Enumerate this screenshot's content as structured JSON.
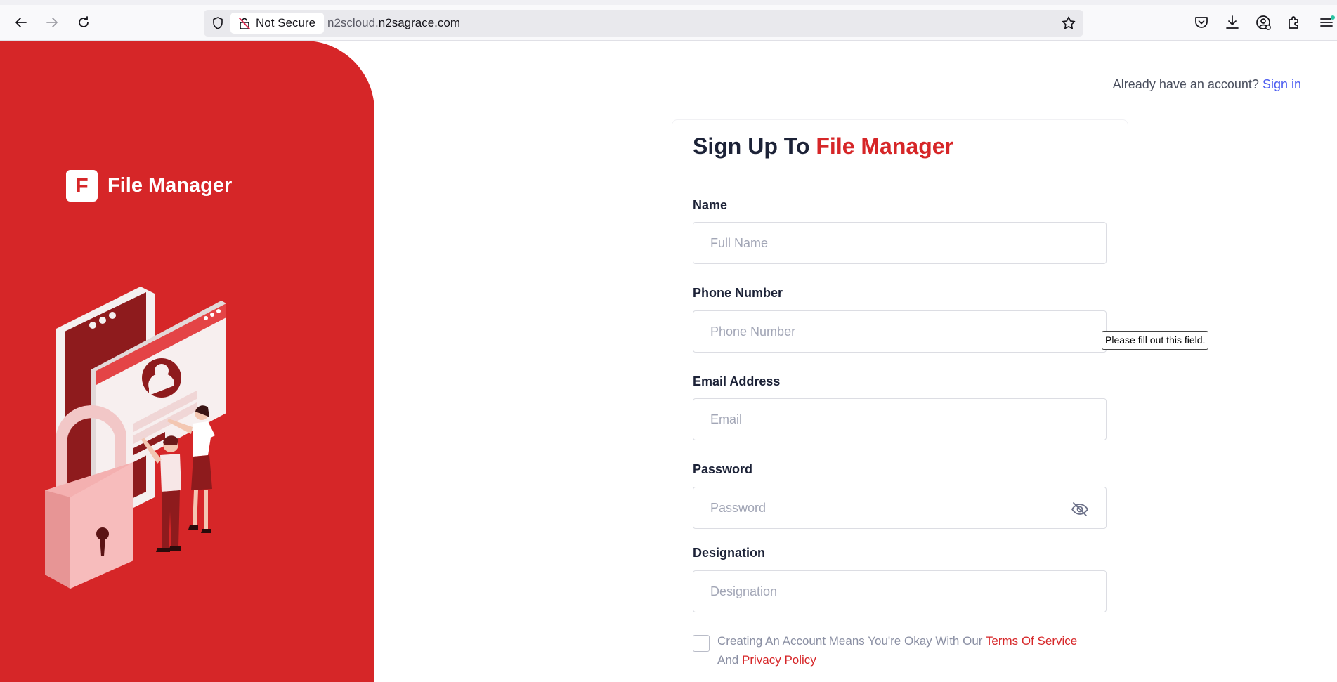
{
  "browser": {
    "security_label": "Not Secure",
    "url_prefix": "n2scloud.",
    "url_domain": "n2sagrace.com"
  },
  "brand": {
    "logo_letter": "F",
    "name": "File Manager"
  },
  "header": {
    "prompt": "Already have an account?",
    "signin_link": "Sign in"
  },
  "form": {
    "title_prefix": "Sign Up To",
    "title_accent": "File Manager",
    "fields": [
      {
        "label": "Name",
        "placeholder": "Full Name",
        "value": ""
      },
      {
        "label": "Phone Number",
        "placeholder": "Phone Number",
        "value": ""
      },
      {
        "label": "Email Address",
        "placeholder": "Email",
        "value": ""
      },
      {
        "label": "Password",
        "placeholder": "Password",
        "value": ""
      },
      {
        "label": "Designation",
        "placeholder": "Designation",
        "value": ""
      }
    ],
    "validation_tooltip": "Please fill out this field.",
    "terms": {
      "text_before": "Creating An Account Means You're Okay With Our",
      "terms_link": "Terms Of Service",
      "and": "And",
      "privacy_link": "Privacy Policy",
      "checked": false
    }
  },
  "colors": {
    "brand_red": "#d62628",
    "link_blue": "#4b5cf0",
    "heading_dark": "#1c2237"
  },
  "icons": [
    "back-arrow-icon",
    "forward-arrow-icon",
    "reload-icon",
    "shield-icon",
    "insecure-lock-icon",
    "bookmark-star-icon",
    "pocket-icon",
    "download-icon",
    "account-icon",
    "extensions-icon",
    "menu-icon",
    "eye-slash-icon"
  ]
}
